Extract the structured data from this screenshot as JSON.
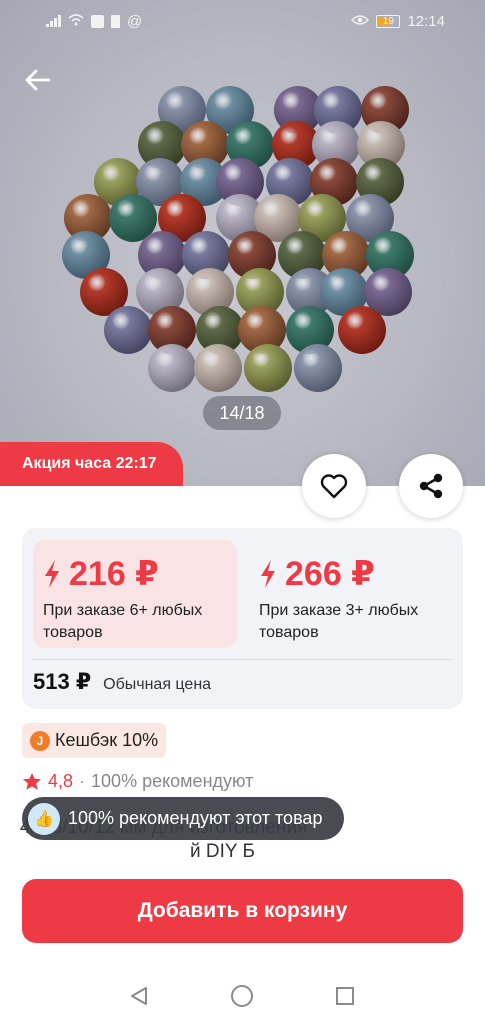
{
  "status_bar": {
    "time": "12:14",
    "battery": "19",
    "notification_glyph": "@"
  },
  "gallery": {
    "counter": "14/18"
  },
  "promo": {
    "label": "Акция часа 22:17"
  },
  "pricing": {
    "tiers": [
      {
        "price": "216 ₽",
        "note": "При заказе 6+ любых товаров"
      },
      {
        "price": "266 ₽",
        "note": "При заказе 3+ любых товаров"
      }
    ],
    "regular_price": "513 ₽",
    "regular_label": "Обычная цена"
  },
  "cashback": {
    "label": "Кешбэк 10%",
    "coin_symbol": "J"
  },
  "rating": {
    "value": "4,8",
    "separator": "·",
    "recommend": "100% рекомендуют"
  },
  "title": {
    "line1": "4/6/8/10/12 мм для изготовления",
    "line2": "й DIY Б"
  },
  "toast": {
    "text": "100% рекомендуют этот товар",
    "icon_glyph": "👍"
  },
  "cart": {
    "label": "Добавить в корзину"
  },
  "colors": {
    "accent": "#ee3a44",
    "promo_bg": "#f9e3e4",
    "card_bg": "#f2f3f7"
  },
  "icons": [
    "back-arrow-icon",
    "heart-icon",
    "share-icon",
    "bolt-icon",
    "star-icon",
    "thumbs-up-icon"
  ]
}
